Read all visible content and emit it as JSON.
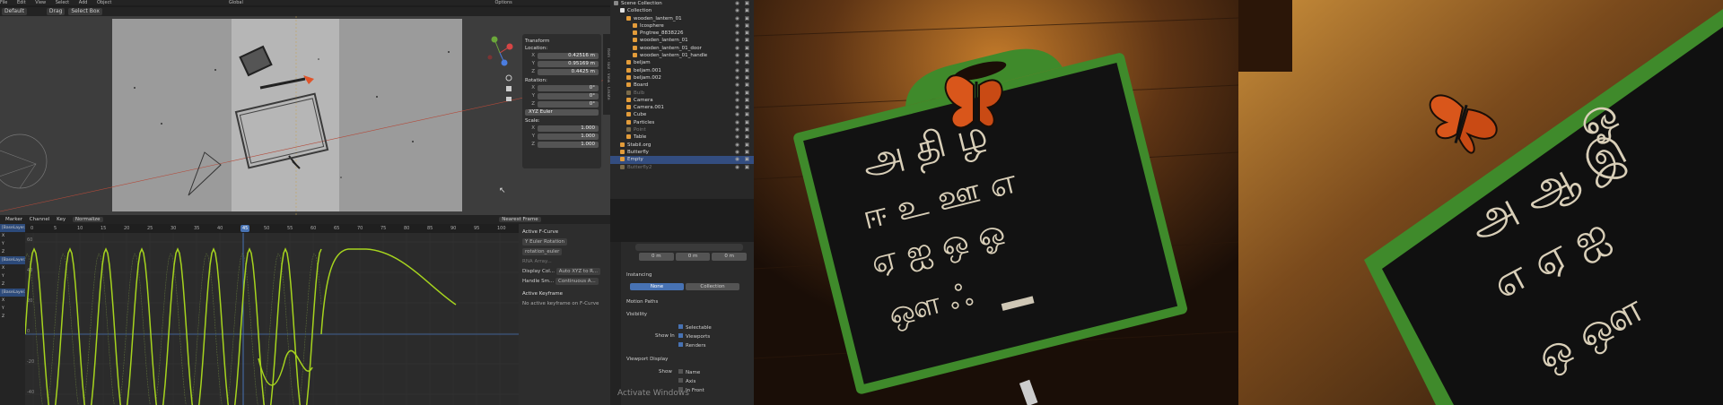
{
  "menubar": {
    "items": [
      "File",
      "Edit",
      "View",
      "Select",
      "Add",
      "Object"
    ],
    "orientation": "Global",
    "options": "Options"
  },
  "vpheader": {
    "mode": "Default",
    "drag": "Drag",
    "select": "Select Box"
  },
  "transform": {
    "title": "Transform",
    "location_label": "Location:",
    "location": [
      {
        "axis": "X",
        "value": "0.42516 m"
      },
      {
        "axis": "Y",
        "value": "0.95169 m"
      },
      {
        "axis": "Z",
        "value": "0.4425 m"
      }
    ],
    "rotation_label": "Rotation:",
    "rotation": [
      {
        "axis": "X",
        "value": "0°"
      },
      {
        "axis": "Y",
        "value": "0°"
      },
      {
        "axis": "Z",
        "value": "0°"
      }
    ],
    "rotation_mode": "XYZ Euler",
    "scale_label": "Scale:",
    "scale": [
      {
        "axis": "X",
        "value": "1.000"
      },
      {
        "axis": "Y",
        "value": "1.000"
      },
      {
        "axis": "Z",
        "value": "1.000"
      }
    ]
  },
  "side_tabs": [
    "Item",
    "Tool",
    "View",
    "Create"
  ],
  "outliner": {
    "rows": [
      {
        "name": "Scene Collection",
        "indent": 0,
        "color": "#8a8a8a"
      },
      {
        "name": "Collection",
        "indent": 1,
        "color": "#e0e0e0"
      },
      {
        "name": "wooden_lantern_01",
        "indent": 2,
        "color": "#e39c3a"
      },
      {
        "name": "Icosphere",
        "indent": 3,
        "color": "#e39c3a"
      },
      {
        "name": "Pngtree_8838226",
        "indent": 3,
        "color": "#e39c3a"
      },
      {
        "name": "wooden_lantern_01",
        "indent": 3,
        "color": "#e39c3a"
      },
      {
        "name": "wooden_lantern_01_door",
        "indent": 3,
        "color": "#e39c3a"
      },
      {
        "name": "wooden_lantern_01_handle",
        "indent": 3,
        "color": "#e39c3a"
      },
      {
        "name": "beljam",
        "indent": 2,
        "color": "#e39c3a"
      },
      {
        "name": "beljam.001",
        "indent": 2,
        "color": "#e39c3a"
      },
      {
        "name": "beljam.002",
        "indent": 2,
        "color": "#e39c3a"
      },
      {
        "name": "Board",
        "indent": 2,
        "color": "#e39c3a"
      },
      {
        "name": "Bulb",
        "indent": 2,
        "color": "#7a6a4a"
      },
      {
        "name": "Camera",
        "indent": 2,
        "color": "#e39c3a"
      },
      {
        "name": "Camera.001",
        "indent": 2,
        "color": "#e39c3a"
      },
      {
        "name": "Cube",
        "indent": 2,
        "color": "#e39c3a"
      },
      {
        "name": "Particles",
        "indent": 2,
        "color": "#e39c3a"
      },
      {
        "name": "Point",
        "indent": 2,
        "color": "#7a6a4a"
      },
      {
        "name": "Table",
        "indent": 2,
        "color": "#e39c3a"
      },
      {
        "name": "Stabil.org",
        "indent": 1,
        "color": "#e39c3a"
      },
      {
        "name": "Butterfly",
        "indent": 1,
        "color": "#e39c3a"
      },
      {
        "name": "Empty",
        "indent": 1,
        "color": "#e39c3a"
      },
      {
        "name": "Butterfly2",
        "indent": 1,
        "color": "#7a6a4a"
      }
    ]
  },
  "graph": {
    "menus": [
      "Marker",
      "Channel",
      "Key"
    ],
    "normalize": "Normalize",
    "nearest_frame": "Nearest Frame",
    "ruler": [
      "0",
      "5",
      "10",
      "15",
      "20",
      "25",
      "30",
      "35",
      "40",
      "45",
      "50",
      "55",
      "60",
      "65",
      "70",
      "75",
      "80",
      "85",
      "90",
      "95",
      "100"
    ],
    "current_frame": "45",
    "yticks": [
      "60",
      "40",
      "20",
      "0",
      "-20",
      "-40"
    ],
    "channels": [
      "[BaseLayer.00",
      "X",
      "Y",
      "Z",
      "[BaseLayer.00",
      "X",
      "Y",
      "Z",
      "[BaseLayer.00",
      "X",
      "Y",
      "Z"
    ]
  },
  "fcurve_panel": {
    "title": "Active F-Curve",
    "channel": "Y Euler Rotation",
    "data_path": "rotation_euler",
    "array_index": "RNA Array...",
    "display_color_label": "Display Col...",
    "display_color_value": "Auto XYZ to R...",
    "handle_label": "Handle Sm...",
    "handle_value": "Continuous A...",
    "keyframe_title": "Active Keyframe",
    "keyframe_msg": "No active keyframe on F-Curve",
    "tabs": [
      "F-Curve",
      "Modifiers",
      "View"
    ]
  },
  "properties": {
    "delta": [
      {
        "axis": "X",
        "value": "0 m"
      },
      {
        "axis": "Y",
        "value": "0 m"
      },
      {
        "axis": "Z",
        "value": "0 m"
      }
    ],
    "instancing": "Instancing",
    "instancing_none": "None",
    "instancing_collection": "Collection",
    "motion_paths": "Motion Paths",
    "visibility": "Visibility",
    "selectable": "Selectable",
    "show_in": "Show In",
    "viewports": "Viewports",
    "renders": "Renders",
    "viewport_display": "Viewport Display",
    "show": "Show",
    "name": "Name",
    "axis": "Axis",
    "in_front": "In Front",
    "activate_windows": "Activate Windows"
  },
  "photo1": {
    "board_line1": "அ  தி  ழ",
    "board_line2": "ஈ  உ  ஊ  எ",
    "board_line3": "ஏ  ஐ  ஒ  ஓ",
    "board_line4": "ஔ  ஃ"
  },
  "photo2": {
    "board_line1": "ஓ",
    "board_line2": "அ  ஆ  இ",
    "board_line3": "எ  ஏ  ஐ",
    "board_line4": "ஒ  ஔ"
  },
  "colors": {
    "curve": "#a6d41e",
    "selection": "#4772b3",
    "board_frame": "#3d8a2a",
    "butterfly": "#d9561b"
  }
}
